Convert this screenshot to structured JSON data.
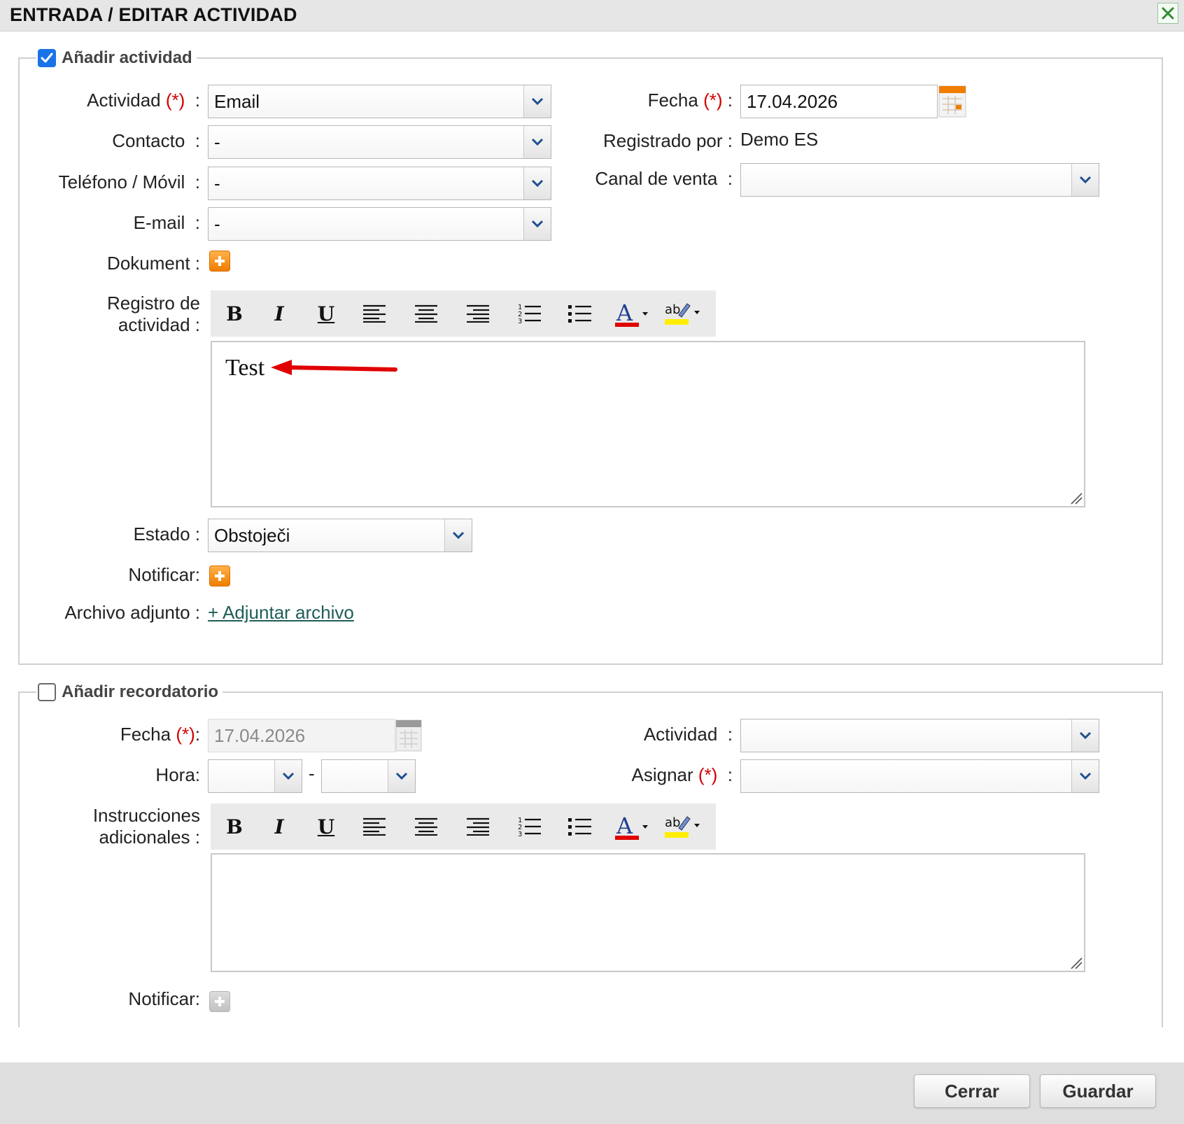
{
  "dialog": {
    "title": "ENTRADA / EDITAR ACTIVIDAD",
    "close_icon": "close-x-icon"
  },
  "activity_section": {
    "legend": "Añadir actividad",
    "checked": true,
    "actividad_label": "Actividad",
    "actividad_value": "Email",
    "contacto_label": "Contacto",
    "contacto_value": "-",
    "telefono_label": "Teléfono / Móvil",
    "telefono_value": "-",
    "email_label": "E-mail",
    "email_value": "-",
    "dokument_label": "Dokument :",
    "registro_label_1": "Registro de",
    "registro_label_2": "actividad :",
    "registro_text": "Test",
    "fecha_label": "Fecha",
    "fecha_value": "17.04.2026",
    "registrado_label": "Registrado por :",
    "registrado_value": "Demo ES",
    "canal_label": "Canal de venta",
    "canal_value": "",
    "estado_label": "Estado :",
    "estado_value": "Obstoječi",
    "notificar_label": "Notificar:",
    "archivo_label": "Archivo adjunto :",
    "archivo_link": "+ Adjuntar archivo"
  },
  "reminder_section": {
    "legend": "Añadir recordatorio",
    "checked": false,
    "fecha_label": "Fecha",
    "fecha_value": "17.04.2026",
    "hora_label": "Hora:",
    "hora_separator": "-",
    "actividad_label": "Actividad",
    "asignar_label": "Asignar",
    "instrucciones_label_1": "Instrucciones",
    "instrucciones_label_2": "adicionales :",
    "notificar_label": "Notificar:"
  },
  "required_marker": "(*)",
  "colon": ":",
  "toolbar": {
    "bold": "B",
    "italic": "I",
    "underline": "U",
    "font_color_letter": "A",
    "highlight_letters": "ab"
  },
  "footer": {
    "cerrar_label": "Cerrar",
    "guardar_label": "Guardar"
  },
  "colors": {
    "accent_blue": "#1a73e8",
    "required_red": "#d00000",
    "plus_orange": "#f07d00",
    "link_green": "#1f5e57",
    "arrow_red": "#e00000"
  }
}
